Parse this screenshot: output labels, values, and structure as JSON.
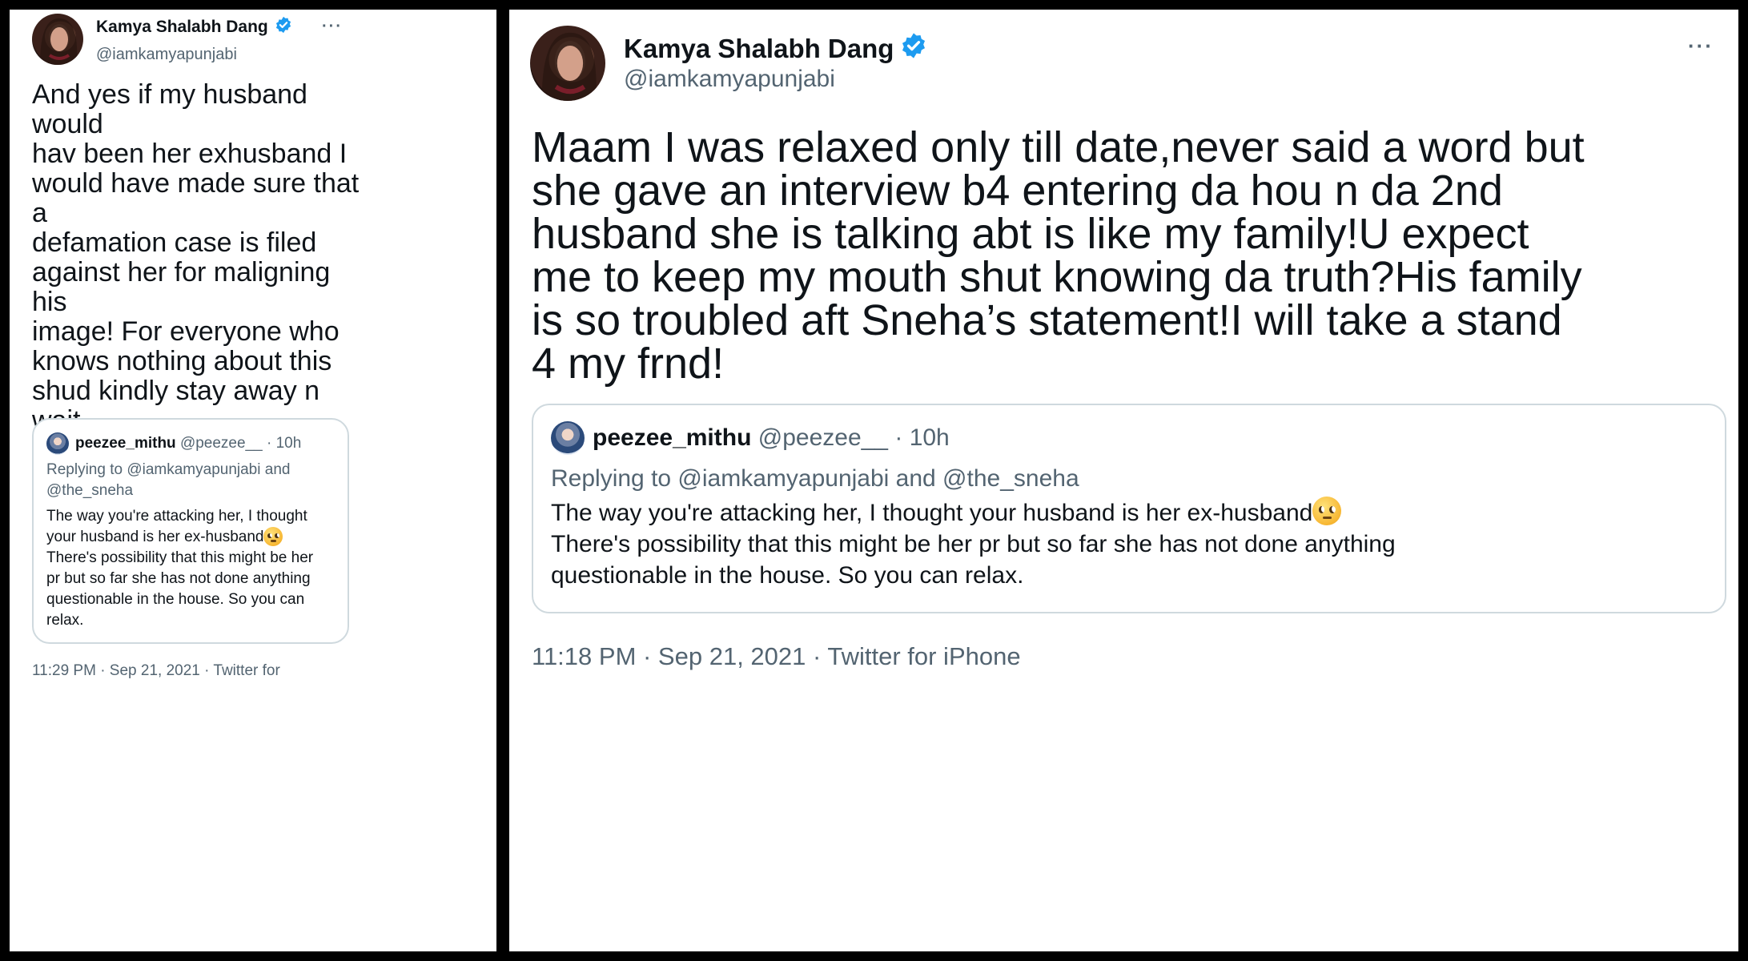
{
  "left_tweet": {
    "author_name": "Kamya Shalabh Dang",
    "author_handle": "@iamkamyapunjabi",
    "more_label": "···",
    "text": "And yes if my husband would\nhav been her exhusband I\nwould have made sure that a\ndefamation case is filed\nagainst her for maligning his\nimage! For everyone who\nknows nothing about this\nshud kindly stay away n wait\ntill the time she comes out n\nclarifies this interview she\ngave!",
    "quote": {
      "name": "peezee_mithu",
      "handle": "@peezee__",
      "separator": "·",
      "time": "10h",
      "replying": "Replying to @iamkamyapunjabi and\n@the_sneha",
      "text_part1": "The way you're attacking her, I thought\nyour husband is her ex-husband",
      "emoji": "face-with-rolling-eyes-emoji",
      "text_part2": "\nThere's possibility that this might be her\npr but so far she has not done anything\nquestionable in the house. So you can\nrelax."
    },
    "footer": "11:29 PM · Sep 21, 2021 · Twitter for"
  },
  "right_tweet": {
    "author_name": "Kamya Shalabh Dang",
    "author_handle": "@iamkamyapunjabi",
    "more_label": "···",
    "text": "Maam I was relaxed only till date,never said a word but\nshe gave an interview b4 entering da hou n da 2nd\nhusband she is talking abt is like my family!U expect\nme to keep my mouth shut knowing da truth?His family\nis so troubled aft Sneha’s statement!I will take a stand\n4 my frnd!",
    "quote": {
      "name": "peezee_mithu",
      "handle": "@peezee__",
      "separator": "·",
      "time": "10h",
      "replying": "Replying to @iamkamyapunjabi and @the_sneha",
      "text_part1": "The way you're attacking her, I thought your husband is her ex-husband",
      "emoji": "face-with-rolling-eyes-emoji",
      "text_part2": "\nThere's possibility that this might be her pr but so far she has not done anything\nquestionable in the house. So you can relax."
    },
    "footer": "11:18 PM · Sep 21, 2021 · Twitter for iPhone"
  },
  "colors": {
    "background": "#000000",
    "card": "#ffffff",
    "text_primary": "#0f1419",
    "text_secondary": "#536471",
    "verified": "#1d9bf0",
    "quote_border": "#cfd9de"
  }
}
